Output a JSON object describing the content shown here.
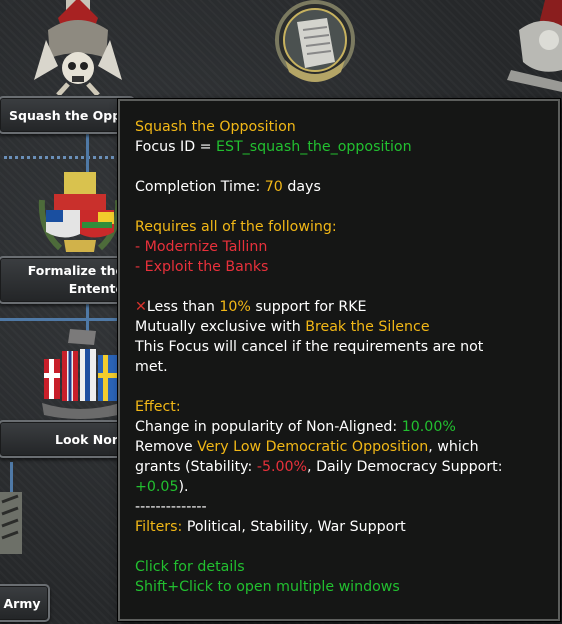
{
  "focus_tree": {
    "nodes": [
      {
        "label": "Squash the Opp"
      },
      {
        "label_line1": "Formalize the",
        "label_line2": "Entente"
      },
      {
        "label": "Look Nort"
      },
      {
        "label": "Army"
      }
    ]
  },
  "tooltip": {
    "title": "Squash the Opposition",
    "focus_id_label": "Focus ID = ",
    "focus_id_value": "EST_squash_the_opposition",
    "completion_label": "Completion Time: ",
    "completion_value": "70",
    "completion_unit": " days",
    "requires_header": "Requires all of the following:",
    "requirements": [
      "- Modernize Tallinn",
      "- Exploit the Banks"
    ],
    "support_prefix": "Less than ",
    "support_value": "10%",
    "support_suffix": " support for RKE",
    "mutex_prefix": "Mutually exclusive with ",
    "mutex_focus": "Break the Silence",
    "cancel_line1": "This Focus will cancel if the requirements are not",
    "cancel_line2": "met.",
    "effect_header": "Effect:",
    "popularity_label": "Change in popularity of Non-Aligned: ",
    "popularity_value": "10.00%",
    "remove_prefix": "Remove ",
    "remove_spirit": "Very Low Democratic Opposition",
    "remove_suffix": ", which",
    "grants_prefix": "grants (Stability: ",
    "grants_stability": "-5.00%",
    "grants_middle": ", Daily Democracy Support:",
    "grants_support": "+0.05",
    "grants_end": ").",
    "separator": "--------------",
    "filters_label": "Filters:",
    "filters_value": " Political, Stability, War Support",
    "click_details": "Click for details",
    "shift_click": "Shift+Click to open multiple windows"
  },
  "colors": {
    "title": "#f2b817",
    "positive": "#22c030",
    "negative": "#e8313b",
    "connector": "#4f79a6"
  }
}
